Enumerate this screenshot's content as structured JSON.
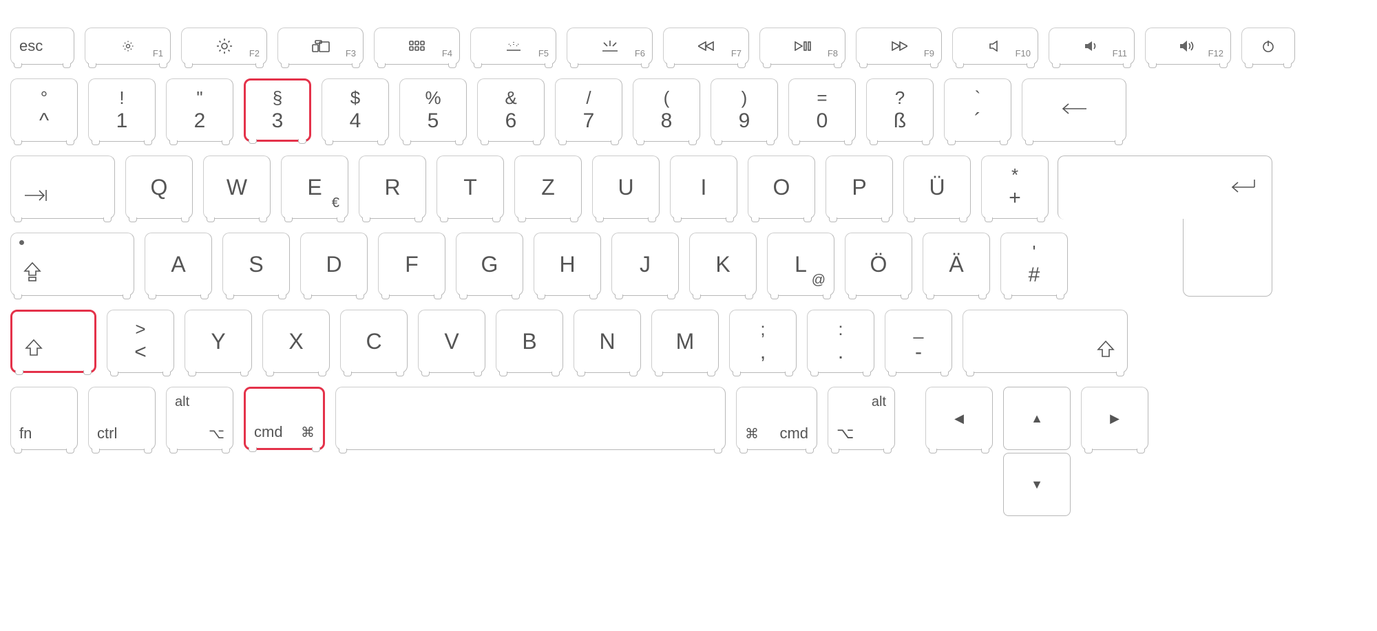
{
  "layout": "mac-german-qwertz",
  "highlighted_keys": [
    "key-3",
    "shift-left",
    "cmd-left"
  ],
  "row0": {
    "esc": "esc",
    "fnlabels": [
      "F1",
      "F2",
      "F3",
      "F4",
      "F5",
      "F6",
      "F7",
      "F8",
      "F9",
      "F10",
      "F11",
      "F12"
    ],
    "fnicons": [
      "brightness-down",
      "brightness-up",
      "mission-control",
      "launchpad",
      "kbd-light-down",
      "kbd-light-up",
      "rewind",
      "play-pause",
      "forward",
      "mute",
      "volume-down",
      "volume-up"
    ],
    "power": "power"
  },
  "row1": [
    {
      "top": "°",
      "bot": "^"
    },
    {
      "top": "!",
      "bot": "1"
    },
    {
      "top": "\"",
      "bot": "2"
    },
    {
      "top": "§",
      "bot": "3",
      "hl": true
    },
    {
      "top": "$",
      "bot": "4"
    },
    {
      "top": "%",
      "bot": "5"
    },
    {
      "top": "&",
      "bot": "6"
    },
    {
      "top": "/",
      "bot": "7"
    },
    {
      "top": "(",
      "bot": "8"
    },
    {
      "top": ")",
      "bot": "9"
    },
    {
      "top": "=",
      "bot": "0"
    },
    {
      "top": "?",
      "bot": "ß"
    },
    {
      "top": "`",
      "bot": "´"
    }
  ],
  "row2": {
    "tab": "tab",
    "keys": [
      "Q",
      "W",
      "E",
      "R",
      "T",
      "Z",
      "U",
      "I",
      "O",
      "P",
      "Ü"
    ],
    "e_sub": "€",
    "plus": {
      "top": "*",
      "bot": "+"
    }
  },
  "row3": {
    "caps": "caps",
    "keys": [
      "A",
      "S",
      "D",
      "F",
      "G",
      "H",
      "J",
      "K",
      "L",
      "Ö",
      "Ä"
    ],
    "l_sub": "@",
    "hash": {
      "top": "'",
      "bot": "#"
    }
  },
  "row4": {
    "shift": "shift",
    "angle": {
      "top": ">",
      "bot": "<"
    },
    "keys": [
      "Y",
      "X",
      "C",
      "V",
      "B",
      "N",
      "M"
    ],
    "p1": {
      "top": ";",
      "bot": ","
    },
    "p2": {
      "top": ":",
      "bot": "."
    },
    "p3": {
      "top": "_",
      "bot": "-"
    }
  },
  "row5": {
    "fn": "fn",
    "ctrl": "ctrl",
    "alt": "alt",
    "cmd": "cmd",
    "cmd_sym": "⌘",
    "opt_sym": "⌥"
  },
  "arrows": {
    "up": "▲",
    "down": "▼",
    "left": "◀",
    "right": "▶"
  }
}
